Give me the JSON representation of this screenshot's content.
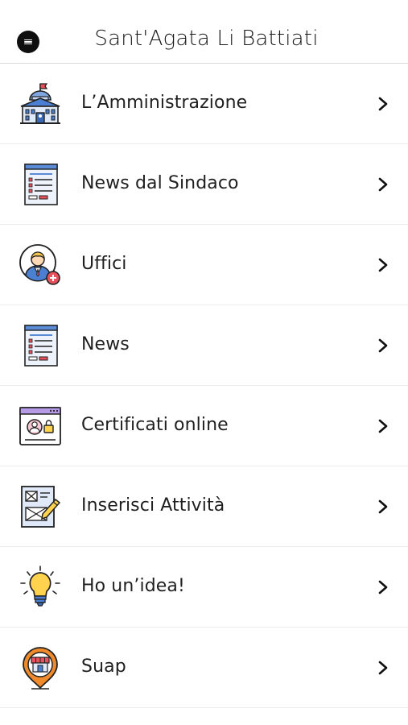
{
  "header": {
    "title": "Sant'Agata Li Battiati",
    "menu_icon": "hamburger-menu-icon"
  },
  "menu": {
    "items": [
      {
        "label": "L’Amministrazione",
        "icon": "town-hall-icon"
      },
      {
        "label": "News dal Sindaco",
        "icon": "news-document-icon"
      },
      {
        "label": "Uffici",
        "icon": "office-user-icon"
      },
      {
        "label": "News",
        "icon": "news-document-icon"
      },
      {
        "label": "Certificati online",
        "icon": "secure-certificate-icon"
      },
      {
        "label": "Inserisci Attività",
        "icon": "edit-form-icon"
      },
      {
        "label": "Ho un’idea!",
        "icon": "lightbulb-icon"
      },
      {
        "label": "Suap",
        "icon": "shop-location-icon"
      }
    ]
  },
  "colors": {
    "divider": "#ececec",
    "text": "#1f1f1f",
    "icon_blue": "#4a7fd1",
    "icon_red": "#e8505b",
    "icon_yellow": "#ffd34e",
    "icon_orange": "#f08a2b"
  }
}
